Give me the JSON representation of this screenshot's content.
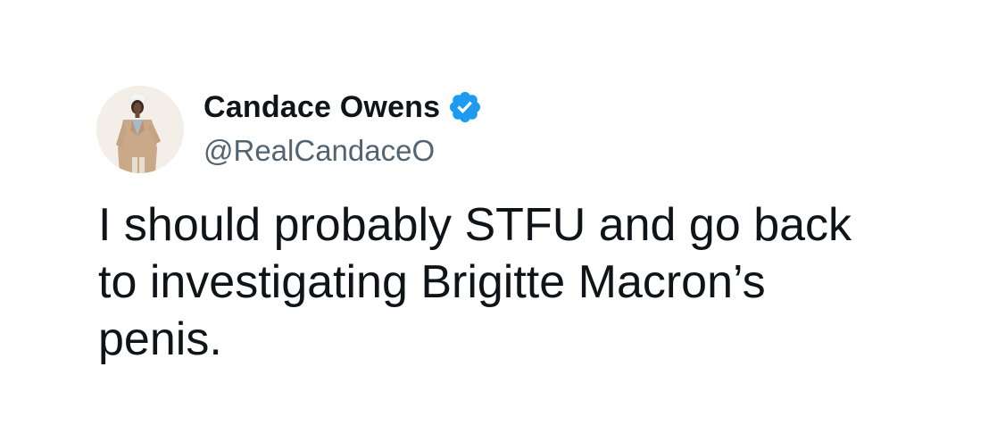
{
  "author": {
    "display_name": "Candace Owens",
    "handle": "@RealCandaceO",
    "verified": true,
    "verified_icon": "verified-badge-icon",
    "verified_color": "#1d9bf0"
  },
  "tweet": {
    "text": "I should probably STFU and go back\nto investigating Brigitte Macron’s\npenis."
  },
  "colors": {
    "name": "#0f1419",
    "handle": "#536471",
    "text": "#0f1419",
    "background": "#ffffff"
  }
}
